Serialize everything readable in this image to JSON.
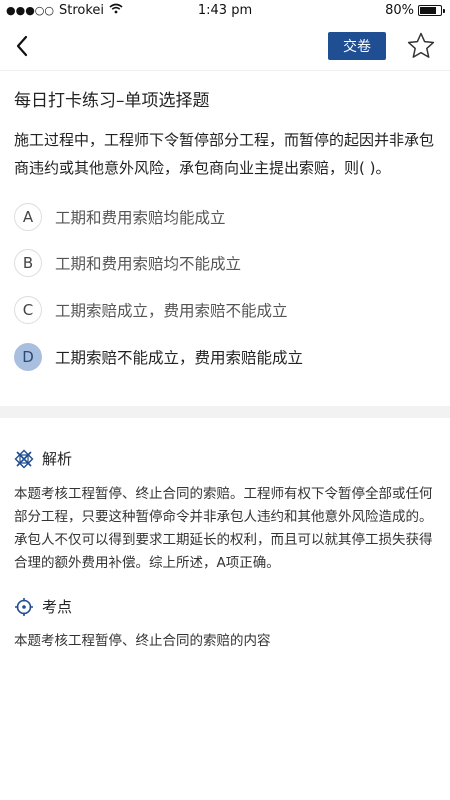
{
  "status_bar": {
    "carrier": "Strokei",
    "time": "1:43 pm",
    "battery_text": "80%",
    "battery_level": 0.8,
    "signal_dots": "●●●○○"
  },
  "nav": {
    "submit_label": "交卷",
    "accent_color": "#1f4e93"
  },
  "quiz": {
    "section_title": "每日打卡练习–单项选择题",
    "question": "施工过程中，工程师下令暂停部分工程，而暂停的起因并非承包商违约或其他意外风险，承包商向业主提出索赔，则( )。",
    "options": [
      {
        "letter": "A",
        "text": "工期和费用索赔均能成立"
      },
      {
        "letter": "B",
        "text": "工期和费用索赔均不能成立"
      },
      {
        "letter": "C",
        "text": "工期索赔成立，费用索赔不能成立"
      },
      {
        "letter": "D",
        "text": "工期索赔不能成立，费用索赔能成立"
      }
    ],
    "selected": "D"
  },
  "analysis": {
    "title": "解析",
    "text": "本题考核工程暂停、终止合同的索赔。工程师有权下令暂停全部或任何部分工程，只要这种暂停命令并非承包人违约和其他意外风险造成的。承包人不仅可以得到要求工期延长的权利，而且可以就其停工损失获得合理的额外费用补偿。综上所述，A项正确。"
  },
  "key_point": {
    "title": "考点",
    "text": "本题考核工程暂停、终止合同的索赔的内容"
  }
}
